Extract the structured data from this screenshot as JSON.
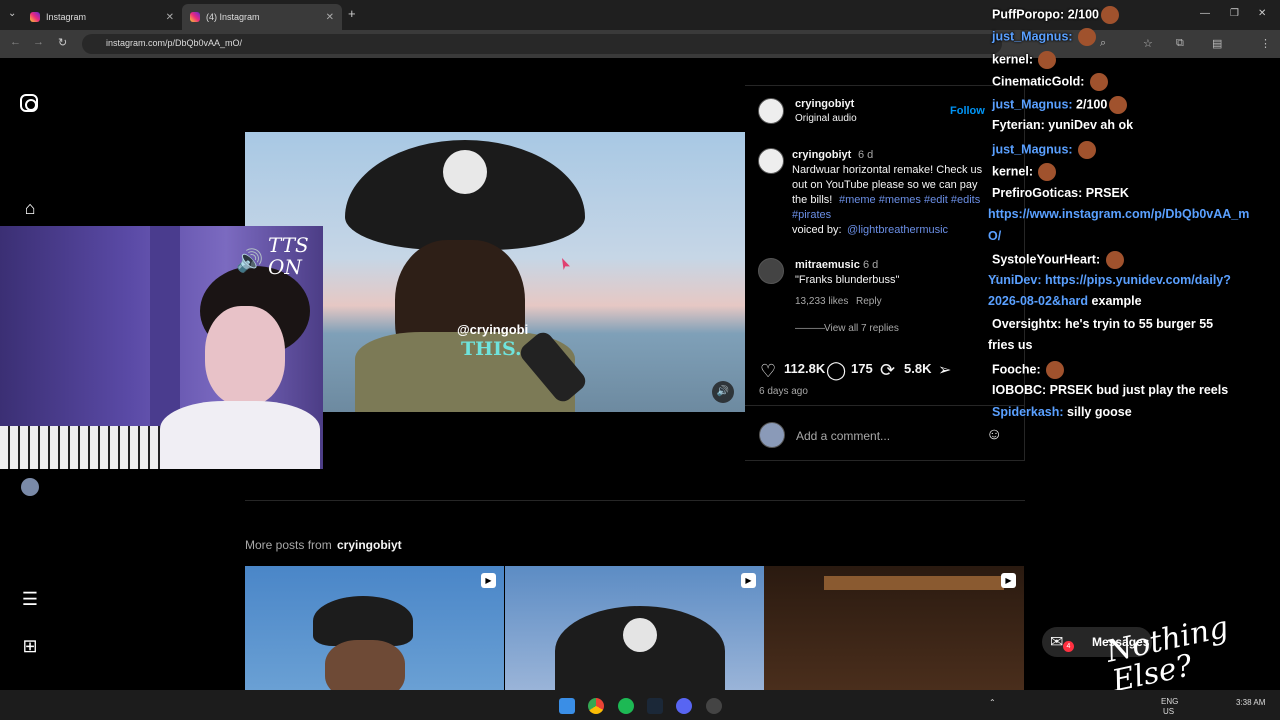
{
  "browser": {
    "tabs": [
      {
        "label": "Instagram"
      },
      {
        "label": "(4) Instagram"
      }
    ],
    "url": "instagram.com/p/DbQb0vAA_mO/"
  },
  "post": {
    "author": "cryingobiyt",
    "audio": "Original audio",
    "follow_label": "Follow",
    "video_overlay_user": "@cryingobi",
    "video_overlay_caption": "THIS.",
    "caption_author": "cryingobiyt",
    "caption_age": "6 d",
    "caption_line1": "Nardwuar horizontal remake! Check us",
    "caption_line2": "out on YouTube please so we can pay",
    "caption_line3_text": "the bills!",
    "caption_tags_line3": "#meme #memes #edit #edits",
    "caption_tags_line4": "#pirates",
    "voiced_by_label": "voiced by:",
    "voiced_by_handle": "@lightbreathermusic",
    "comment": {
      "author": "mitraemusic",
      "age": "6 d",
      "text": "\"Franks blunderbuss\"",
      "likes": "13,233 likes",
      "reply_label": "Reply",
      "view_replies": "View all 7 replies"
    },
    "likes": "112.8K",
    "comments_count": "175",
    "reposts": "5.8K",
    "date": "6 days ago",
    "add_comment_placeholder": "Add a comment..."
  },
  "more_posts": {
    "label": "More posts from",
    "author": "cryingobiyt"
  },
  "messages": {
    "label": "Messages",
    "badge": "4"
  },
  "stream": {
    "tts_label": "TTS ON",
    "watermark": "Nothing Else?"
  },
  "chat": [
    {
      "user": "PuffPoropo:",
      "text": "2/100",
      "blue": false
    },
    {
      "user": "just_Magnus:",
      "text": "",
      "blue": true
    },
    {
      "user": "kernel:",
      "text": "",
      "blue": false
    },
    {
      "user": "CinematicGold:",
      "text": "",
      "blue": false
    },
    {
      "user": "just_Magnus:",
      "text": "2/100",
      "blue": true
    },
    {
      "user": "Fyterian:",
      "text": "yuniDev ah ok",
      "blue": false
    },
    {
      "user": "just_Magnus:",
      "text": "",
      "blue": true
    },
    {
      "user": "kernel:",
      "text": "",
      "blue": false
    },
    {
      "user": "PrefiroGoticas:",
      "text": "PRSEK",
      "blue": false
    },
    {
      "user": "",
      "text": "https://www.instagram.com/p/DbQb0vAA_m",
      "blue": true
    },
    {
      "user": "",
      "text": "O/",
      "blue": true
    },
    {
      "user": "SystoleYourHeart:",
      "text": "",
      "blue": false
    },
    {
      "user": "YuniDev:",
      "text": "https://pips.yunidev.com/daily?",
      "blue": true
    },
    {
      "user": "",
      "text": "2026-08-02&hard",
      "blue": true,
      "suffix": "example"
    },
    {
      "user": "Oversightx:",
      "text": "he's tryin to 55 burger 55",
      "blue": false
    },
    {
      "user": "",
      "text": "fries us",
      "blue": false
    },
    {
      "user": "Fooche:",
      "text": "",
      "blue": false
    },
    {
      "user": "IOBOBC:",
      "text": "PRSEK bud just play the reels",
      "blue": false
    },
    {
      "user": "Spiderkash:",
      "text": "silly goose",
      "blue": true
    }
  ],
  "taskbar": {
    "lang": "ENG",
    "region": "US",
    "time": "3:38 AM"
  },
  "colors": {
    "accent": "#0095f6",
    "link": "#6b8fe6",
    "chat_blue": "#5aa0ff"
  }
}
